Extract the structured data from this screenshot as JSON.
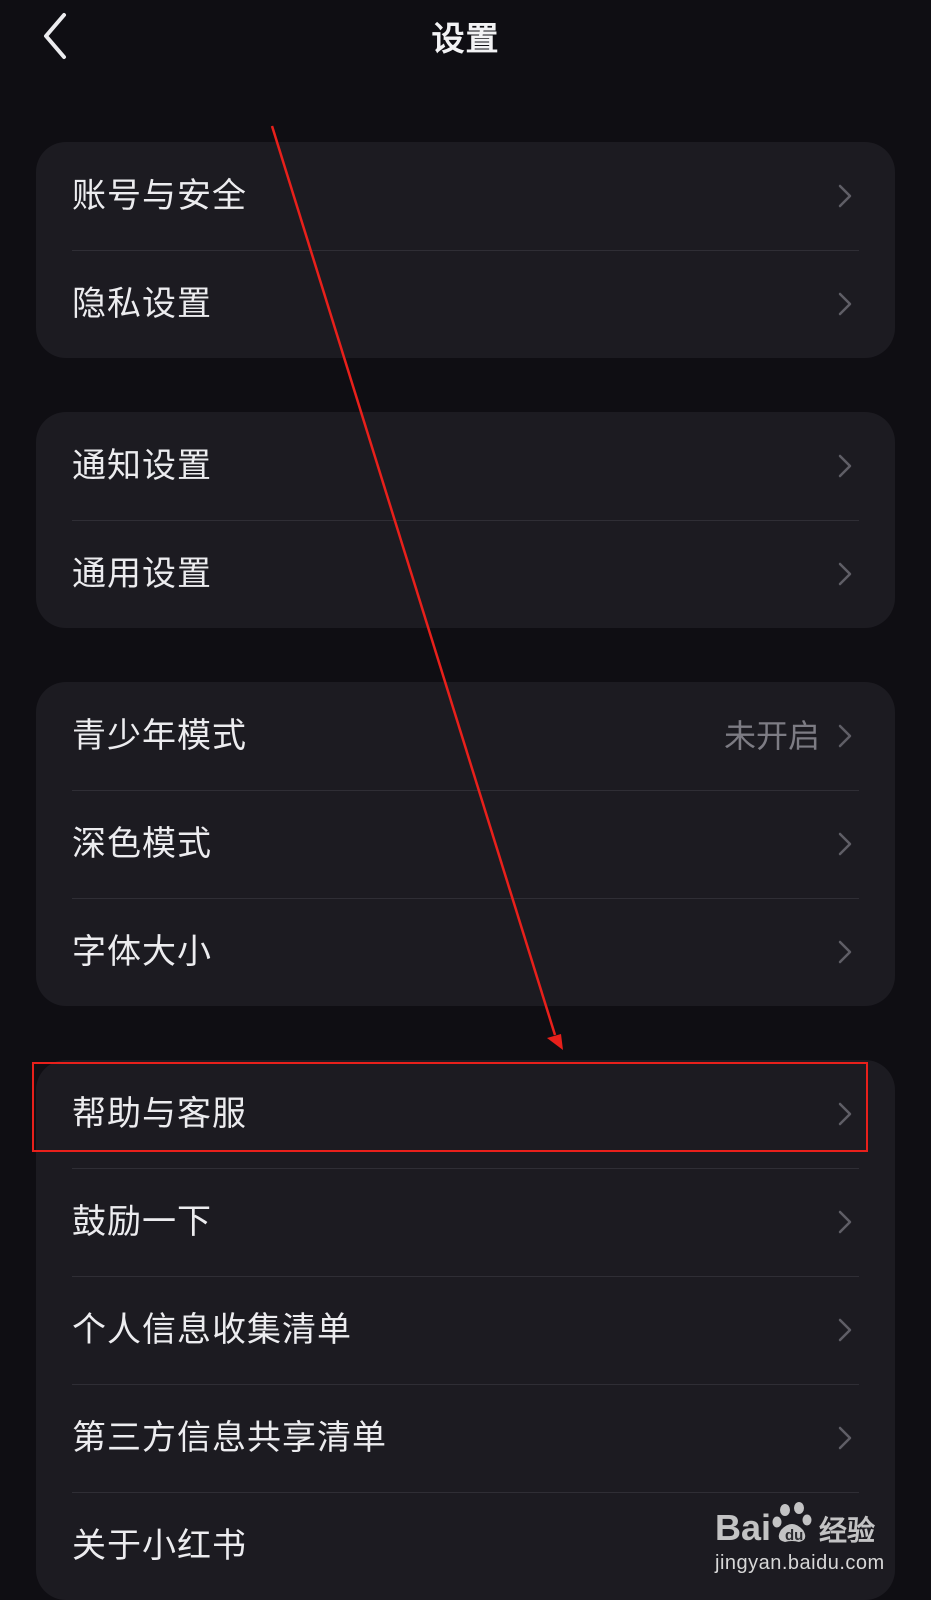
{
  "header": {
    "title": "设置"
  },
  "groups": [
    {
      "items": [
        {
          "label": "账号与安全"
        },
        {
          "label": "隐私设置"
        }
      ]
    },
    {
      "items": [
        {
          "label": "通知设置"
        },
        {
          "label": "通用设置"
        }
      ]
    },
    {
      "items": [
        {
          "label": "青少年模式",
          "value": "未开启"
        },
        {
          "label": "深色模式"
        },
        {
          "label": "字体大小"
        }
      ]
    },
    {
      "items": [
        {
          "label": "帮助与客服"
        },
        {
          "label": "鼓励一下"
        },
        {
          "label": "个人信息收集清单"
        },
        {
          "label": "第三方信息共享清单"
        },
        {
          "label": "关于小红书"
        }
      ]
    }
  ],
  "watermark": {
    "brand": "Bai经验",
    "url": "jingyan.baidu.com"
  },
  "colors": {
    "background": "#0f0e13",
    "card": "#1c1b21",
    "annotation": "#e8201b"
  },
  "icons": {
    "back": "chevron-left-icon",
    "row": "chevron-right-icon"
  }
}
